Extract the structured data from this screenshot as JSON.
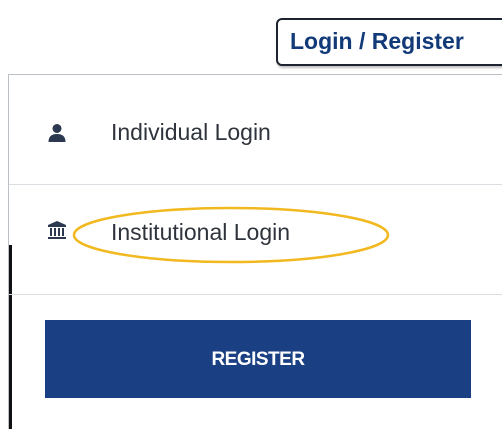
{
  "header": {
    "login_register_label": "Login / Register"
  },
  "menu": {
    "items": [
      {
        "label": "Individual Login",
        "icon": "user-icon"
      },
      {
        "label": "Institutional Login",
        "icon": "institution-icon",
        "highlighted": true
      }
    ],
    "register_label": "REGISTER"
  },
  "colors": {
    "brand_blue": "#1a3f82",
    "text_dark": "#2f343c",
    "highlight_yellow": "#f1b81f",
    "border": "#1d2330"
  }
}
